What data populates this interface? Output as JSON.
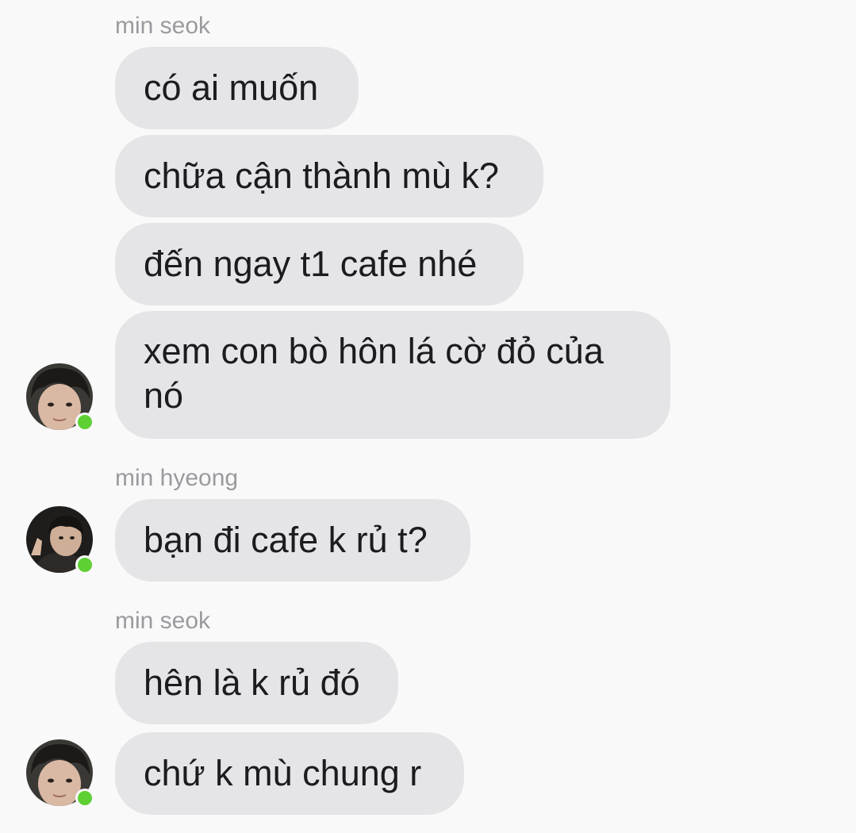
{
  "thread": {
    "groups": [
      {
        "sender": "min seok",
        "messages": [
          "có ai muốn",
          "chữa cận thành mù k?",
          "đến ngay t1 cafe nhé",
          "xem con bò hôn lá cờ đỏ của nó"
        ]
      },
      {
        "sender": "min hyeong",
        "messages": [
          "bạn đi cafe k rủ t?"
        ]
      },
      {
        "sender": "min seok",
        "messages": [
          "hên là k rủ đó",
          "chứ k mù chung r"
        ]
      }
    ]
  },
  "colors": {
    "background": "#f9f9f9",
    "bubble": "#e5e5e7",
    "text": "#1c1c1e",
    "sender_name": "#9a9a9f",
    "online_indicator": "#5ed034"
  },
  "icons": {
    "avatar": "user-photo-avatar",
    "presence": "online-status-dot"
  }
}
